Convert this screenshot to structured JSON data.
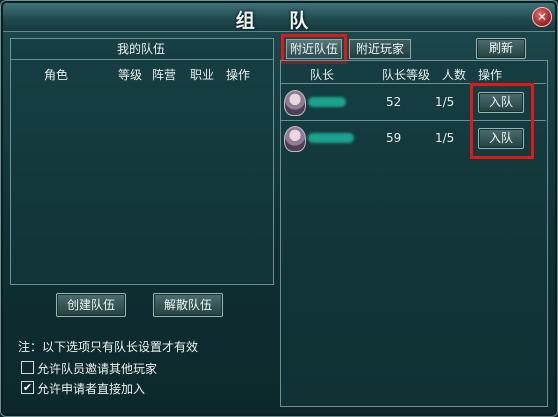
{
  "window": {
    "title": "组 队",
    "close_glyph": "✕"
  },
  "my_team": {
    "title": "我的队伍",
    "columns": [
      "角色",
      "等级",
      "阵营",
      "职业",
      "操作"
    ],
    "create_button": "创建队伍",
    "disband_button": "解散队伍"
  },
  "tabs": {
    "nearby_teams": "附近队伍",
    "nearby_players": "附近玩家",
    "refresh": "刷新"
  },
  "nearby": {
    "columns": [
      "队长",
      "队长等级",
      "人数",
      "操作"
    ],
    "rows": [
      {
        "level": "52",
        "members": "1/5",
        "action": "入队"
      },
      {
        "level": "59",
        "members": "1/5",
        "action": "入队"
      }
    ]
  },
  "options": {
    "note": "注：以下选项只有队长设置才有效",
    "allow_invite_label": "允许队员邀请其他玩家",
    "allow_invite_checked": false,
    "auto_accept_label": "允许申请者直接加入",
    "auto_accept_checked": true,
    "check_glyph": "✔"
  },
  "colors": {
    "highlight_box": "#e01818",
    "name_redaction": "#1dae96"
  }
}
